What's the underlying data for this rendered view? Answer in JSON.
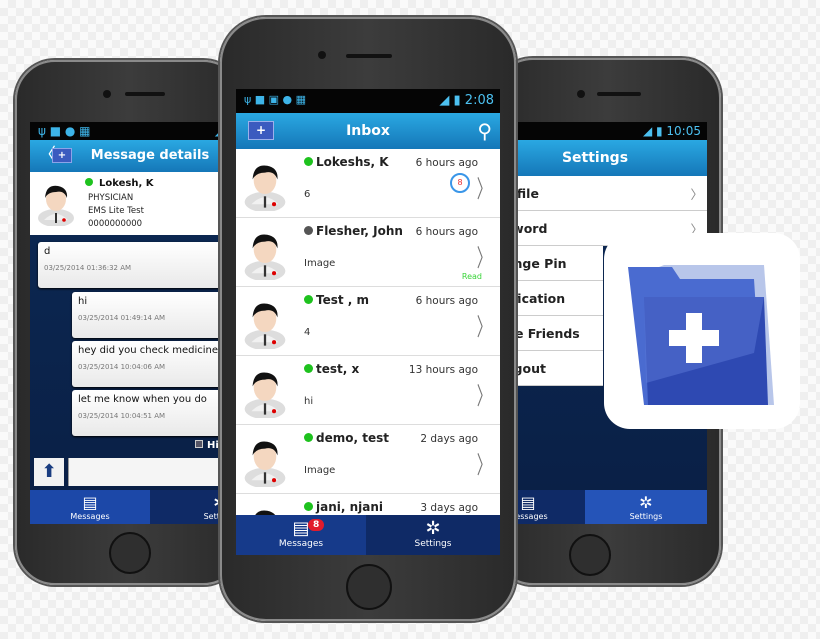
{
  "colors": {
    "header_blue": "#1e8fd0",
    "nav_blue": "#0f2a66",
    "nav_active": "#2554b8",
    "online": "#1ec21e",
    "offline": "#555555",
    "read": "#39d439",
    "badge": "#e21b2c"
  },
  "left_phone": {
    "header": {
      "title": "Message details",
      "back_icon": "chevron-left-icon",
      "logo_icon": "folder-plus-icon"
    },
    "contact": {
      "name": "Lokesh, K",
      "role": "PHYSICIAN",
      "org": "EMS Lite Test",
      "phone": "0000000000"
    },
    "messages": [
      {
        "text": "d",
        "timestamp": "03/25/2014 01:36:32 AM"
      },
      {
        "text": "hi",
        "timestamp": "03/25/2014 01:49:14 AM"
      },
      {
        "text": "hey did you check medicine",
        "timestamp": "03/25/2014 10:04:06 AM"
      },
      {
        "text": "let me know when you do",
        "timestamp": "03/25/2014 10:04:51 AM"
      }
    ],
    "checkbox_label": "Hi",
    "nav": {
      "messages": "Messages",
      "settings": "Settings"
    }
  },
  "center_phone": {
    "status_time": "2:08",
    "header": {
      "title": "Inbox",
      "search_icon": "search-icon",
      "logo_icon": "folder-plus-icon"
    },
    "inbox": [
      {
        "name": "Lokeshs, K",
        "status": "online",
        "time": "6 hours ago",
        "preview": "6",
        "unread": "8"
      },
      {
        "name": "Flesher, John",
        "status": "offline",
        "time": "6 hours ago",
        "preview": "Image",
        "read_label": "Read"
      },
      {
        "name": "Test , m",
        "status": "online",
        "time": "6 hours ago",
        "preview": "4"
      },
      {
        "name": "test, x",
        "status": "online",
        "time": "13 hours ago",
        "preview": "hi"
      },
      {
        "name": "demo, test",
        "status": "online",
        "time": "2 days ago",
        "preview": "Image"
      },
      {
        "name": "jani, njani",
        "status": "online",
        "time": "3 days ago",
        "preview": ""
      }
    ],
    "nav": {
      "messages": "Messages",
      "messages_badge": "8",
      "settings": "Settings"
    }
  },
  "right_phone": {
    "status_time": "10:05",
    "header": {
      "title": "Settings"
    },
    "items": [
      "Profile",
      "Password",
      "Change Pin",
      "Notification",
      "Invite Friends",
      "Logout"
    ],
    "nav": {
      "messages": "Messages",
      "settings": "Settings"
    }
  },
  "app_icon": {
    "name": "folder-plus-app-icon"
  }
}
